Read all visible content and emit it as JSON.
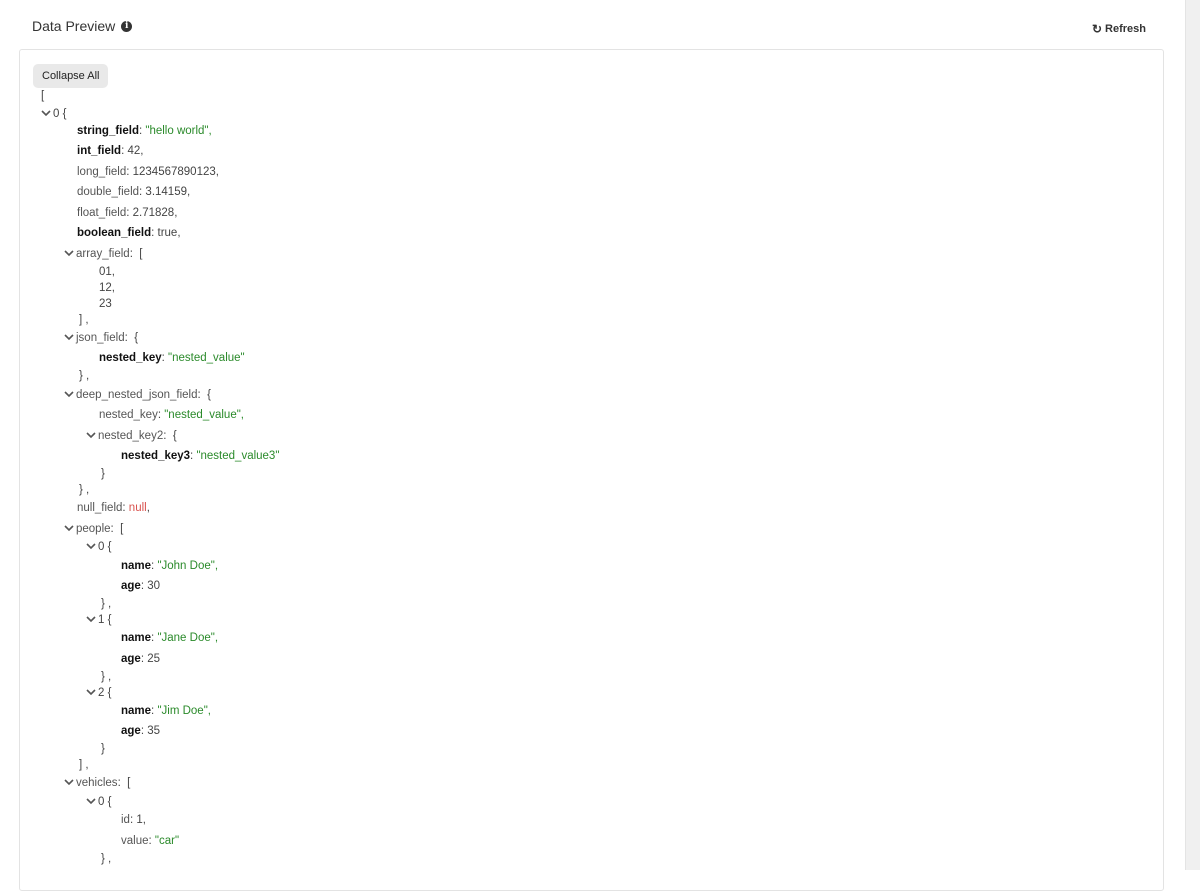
{
  "header": {
    "title": "Data Preview",
    "info_icon": "info-icon"
  },
  "toolbar": {
    "refresh_label": "Refresh",
    "refresh_icon": "refresh-icon",
    "collapse_label": "Collapse All"
  },
  "json": {
    "open_bracket": "[",
    "item0": {
      "index": "0 {",
      "string_field": {
        "key": "string_field",
        "value": "\"hello world\","
      },
      "int_field": {
        "key": "int_field",
        "value": "42,"
      },
      "long_field": {
        "key": "long_field",
        "value": "1234567890123,"
      },
      "double_field": {
        "key": "double_field",
        "value": "3.14159,"
      },
      "float_field": {
        "key": "float_field",
        "value": "2.71828,"
      },
      "boolean_field": {
        "key": "boolean_field",
        "value": "true,"
      },
      "array_field": {
        "key": "array_field",
        "open": "[",
        "items": [
          "01,",
          "12,",
          "23"
        ],
        "close": "] ,"
      },
      "json_field": {
        "key": "json_field",
        "open": "{",
        "nested_key": "nested_key",
        "nested_value": "\"nested_value\"",
        "close": "} ,"
      },
      "deep_nested_json_field": {
        "key": "deep_nested_json_field",
        "open": "{",
        "nested_key": "nested_key",
        "nested_value": "\"nested_value\",",
        "nested_key2": "nested_key2",
        "nested_key2_open": "{",
        "nested_key3": "nested_key3",
        "nested_value3": "\"nested_value3\"",
        "nested_key2_close": "}",
        "close": "} ,"
      },
      "null_field": {
        "key": "null_field",
        "value": "null",
        "comma": ","
      },
      "people": {
        "key": "people",
        "open": "[",
        "close": "] ,",
        "items": [
          {
            "index": "0 {",
            "name_key": "name",
            "name": "\"John Doe\",",
            "age_key": "age",
            "age": "30",
            "close": "} ,"
          },
          {
            "index": "1 {",
            "name_key": "name",
            "name": "\"Jane Doe\",",
            "age_key": "age",
            "age": "25",
            "close": "} ,"
          },
          {
            "index": "2 {",
            "name_key": "name",
            "name": "\"Jim Doe\",",
            "age_key": "age",
            "age": "35",
            "close": "}"
          }
        ]
      },
      "vehicles": {
        "key": "vehicles",
        "open": "[",
        "items": [
          {
            "index": "0 {",
            "id_key": "id",
            "id": "1,",
            "value_key": "value",
            "value": "\"car\"",
            "close": "} ,"
          }
        ]
      }
    }
  }
}
